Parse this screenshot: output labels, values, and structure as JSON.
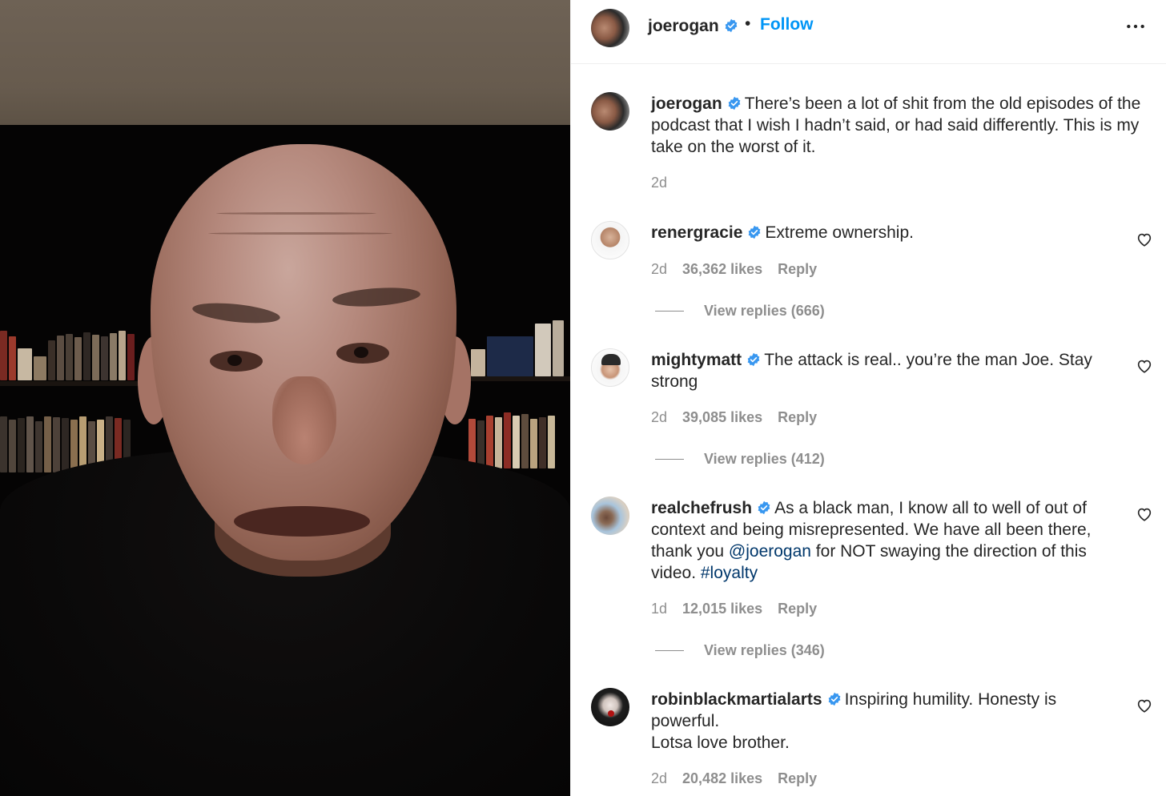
{
  "header": {
    "username": "joerogan",
    "follow_label": "Follow",
    "separator": "•"
  },
  "caption": {
    "username": "joerogan",
    "text": "There’s been a lot of shit from the old episodes of the podcast that I wish I hadn’t said, or had said differently. This is my take on the worst of it.",
    "time": "2d"
  },
  "comments": [
    {
      "username": "renergracie",
      "text": "Extreme ownership.",
      "time": "2d",
      "likes": "36,362 likes",
      "reply_label": "Reply",
      "view_replies": "View replies (666)"
    },
    {
      "username": "mightymatt",
      "text": "The attack is real.. you’re the man Joe. Stay strong",
      "time": "2d",
      "likes": "39,085 likes",
      "reply_label": "Reply",
      "view_replies": "View replies (412)"
    },
    {
      "username": "realchefrush",
      "text_before": "As a black man, I know all to well of out of context and being misrepresented. We have all been there, thank you ",
      "mention": "@joerogan",
      "text_middle": " for NOT swaying the direction of this video. ",
      "hashtag": "#loyalty",
      "time": "1d",
      "likes": "12,015 likes",
      "reply_label": "Reply",
      "view_replies": "View replies (346)"
    },
    {
      "username": "robinblackmartialarts",
      "text_line1": "Inspiring humility. Honesty is powerful.",
      "text_line2": "Lotsa love brother.",
      "time": "2d",
      "likes": "20,482 likes",
      "reply_label": "Reply"
    }
  ],
  "icons": {
    "verified": "verified-badge-icon",
    "more": "more-options-icon",
    "like": "heart-icon"
  },
  "colors": {
    "link_blue": "#0095f6",
    "verified_blue": "#3897f0",
    "meta_gray": "#8e8e8e",
    "mention_navy": "#00376b"
  }
}
